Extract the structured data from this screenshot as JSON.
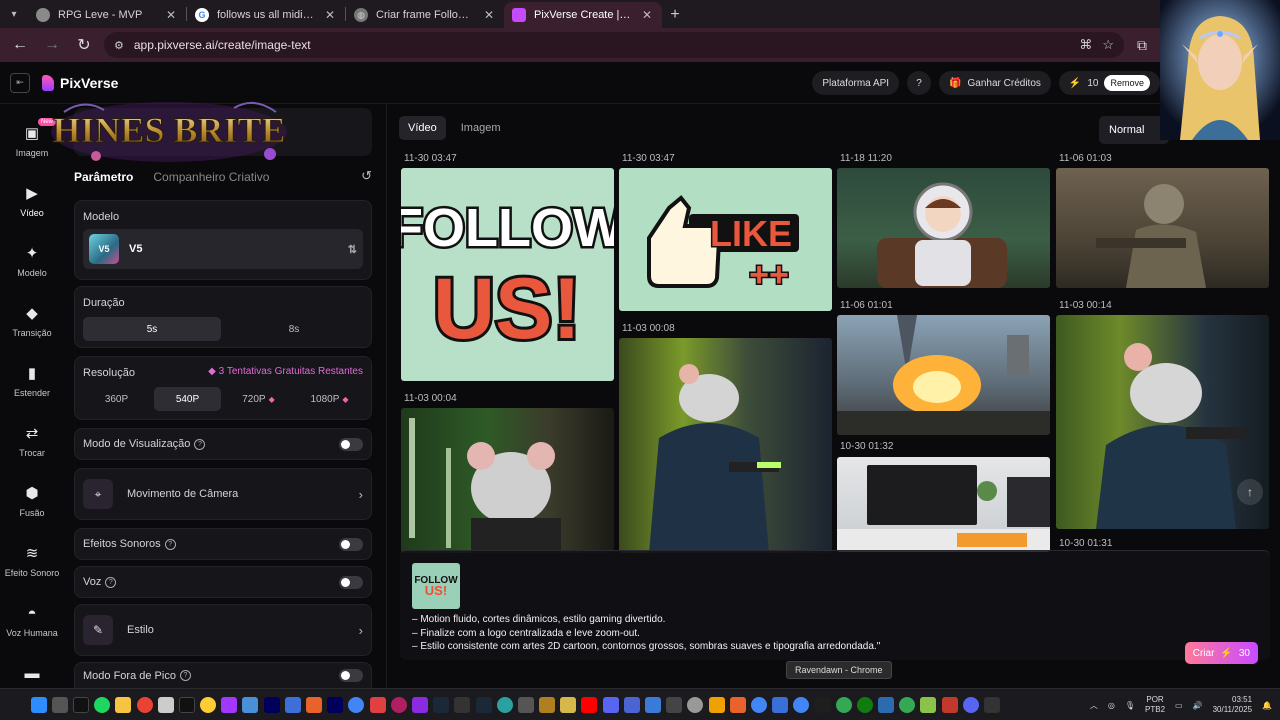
{
  "browser": {
    "tabs": [
      {
        "title": "RPG Leve - MVP",
        "fav_color": "#8a8a8a"
      },
      {
        "title": "follows us all midias - Pesqu",
        "fav_color": "#8a8a8a"
      },
      {
        "title": "Criar frame Follow us",
        "fav_color": "#8a8a8a"
      },
      {
        "title": "PixVerse Create | Make AI Vi",
        "fav_color": "#c44bff",
        "active": true
      }
    ],
    "url": "app.pixverse.ai/create/image-text"
  },
  "app": {
    "logo": "PixVerse",
    "brand_overlay": "HINES BRITE",
    "header": {
      "api_label": "Plataforma API",
      "credits_label": "Ganhar Créditos",
      "credit_count": "10",
      "remove_label": "Remove"
    },
    "sidebar": [
      {
        "label": "Imagem",
        "icon": "image-icon",
        "glyph": "▣",
        "badge": "New"
      },
      {
        "label": "Vídeo",
        "icon": "video-icon",
        "glyph": "▶",
        "active": true
      },
      {
        "label": "Modelo",
        "icon": "sparkle-icon",
        "glyph": "✦"
      },
      {
        "label": "Transição",
        "icon": "transition-icon",
        "glyph": "◆"
      },
      {
        "label": "Estender",
        "icon": "extend-icon",
        "glyph": "▮"
      },
      {
        "label": "Trocar",
        "icon": "swap-icon",
        "glyph": "⇄"
      },
      {
        "label": "Fusão",
        "icon": "fusion-icon",
        "glyph": "⬢"
      },
      {
        "label": "Efeito Sonoro",
        "icon": "audio-wave-icon",
        "glyph": "≋"
      },
      {
        "label": "Voz Humana",
        "icon": "lips-icon",
        "glyph": "◓"
      },
      {
        "label": "",
        "icon": "more-icon",
        "glyph": "▬"
      }
    ],
    "panel": {
      "tabs": [
        "Parâmetro",
        "Companheiro Criativo"
      ],
      "model": {
        "label": "Modelo",
        "value": "V5",
        "thumb_text": "V5"
      },
      "duration": {
        "label": "Duração",
        "options": [
          "5s",
          "8s"
        ],
        "selected": "5s"
      },
      "resolution": {
        "label": "Resolução",
        "tries": "3 Tentativas Gratuitas Restantes",
        "options": [
          "360P",
          "540P",
          "720P",
          "1080P"
        ],
        "selected": "540P"
      },
      "preview_mode": "Modo de Visualização",
      "camera_move": "Movimento de Câmera",
      "sound_effects": "Efeitos Sonoros",
      "voice": "Voz",
      "style": "Estilo",
      "off_peak": "Modo Fora de Pico"
    },
    "gallery": {
      "tabs": [
        "Vídeo",
        "Imagem"
      ],
      "mode": "Normal",
      "stamps": [
        "11-30 03:47",
        "11-30 03:47",
        "11-18 11:20",
        "11-06 01:03",
        "11-06 01:01",
        "11-03 00:14",
        "11-03 00:08",
        "11-03 00:04",
        "10-30 01:32",
        "10-30 01:31"
      ],
      "thumbs": {
        "follow_line1": "FOLLOW",
        "follow_line2": "US!",
        "like_line1": "LIKE",
        "like_line2": "++"
      }
    },
    "prompt": {
      "thumb_line1": "FOLLOW",
      "thumb_line2": "US!",
      "lines": [
        "– Motion fluido, cortes dinâmicos, estilo gaming divertido.",
        "– Finalize com a logo centralizada e leve zoom-out.",
        "– Estilo consistente com artes 2D cartoon, contornos grossos, sombras suaves e tipografia arredondada.\""
      ],
      "create_label": "Criar",
      "create_cost": "30"
    },
    "tooltip": "Ravendawn - Chrome"
  },
  "taskbar": {
    "lang": "POR",
    "layout": "PTB2",
    "time": "03:51",
    "date": "30/11/2025"
  }
}
